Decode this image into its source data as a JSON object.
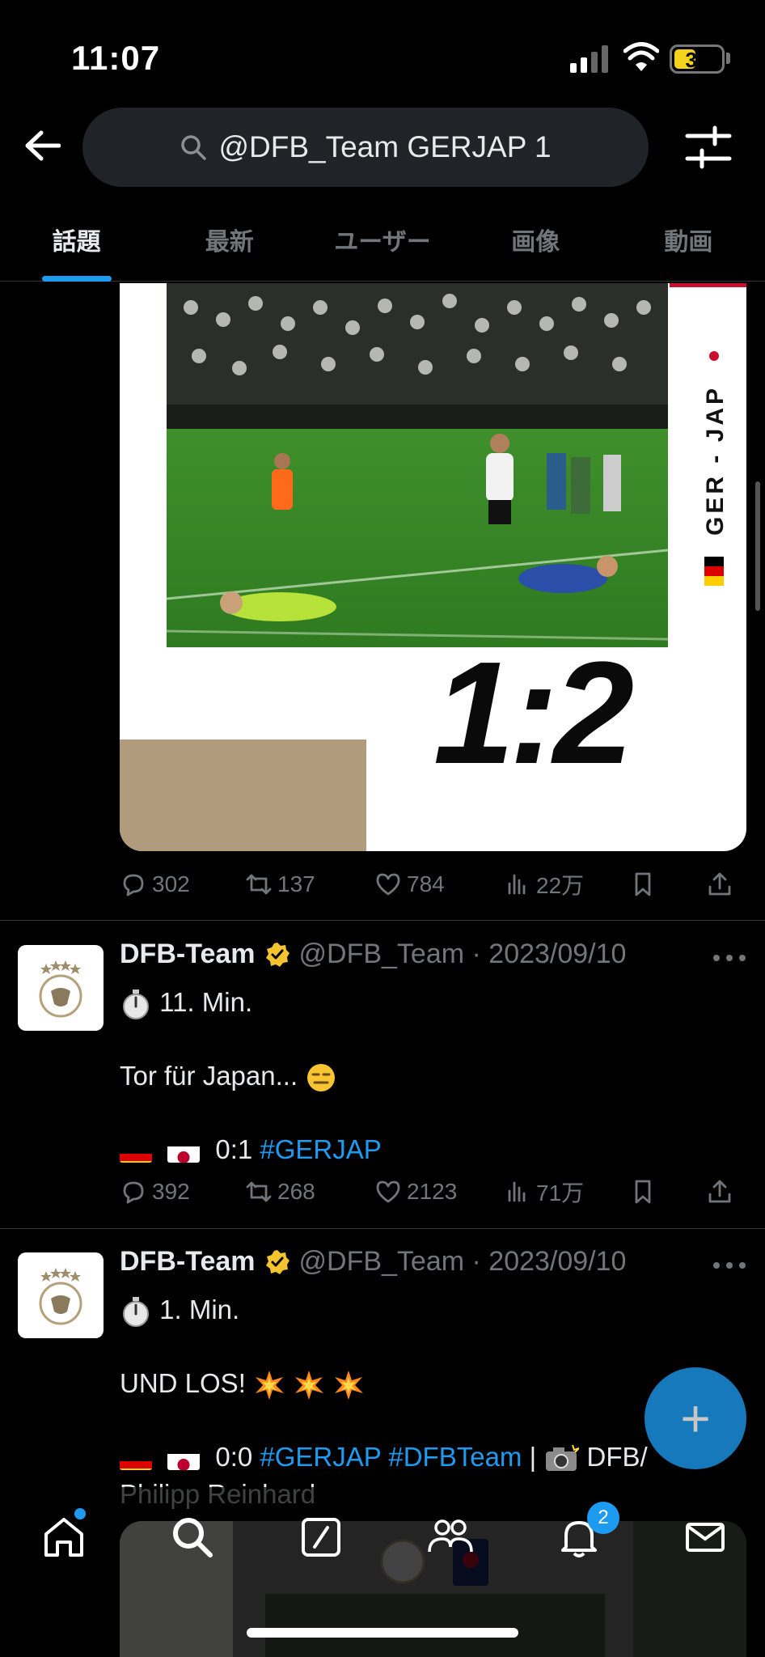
{
  "status": {
    "time": "11:07",
    "battery": "31"
  },
  "search": {
    "query": "@DFB_Team GERJAP 1"
  },
  "tabs": [
    {
      "label": "話題"
    },
    {
      "label": "最新"
    },
    {
      "label": "ユーザー"
    },
    {
      "label": "画像"
    },
    {
      "label": "動画"
    }
  ],
  "media": {
    "score": "1:2",
    "side_label": "GER - JAP"
  },
  "tweet0_stats": {
    "replies": "302",
    "retweets": "137",
    "likes": "784",
    "views": "22万"
  },
  "tweets": [
    {
      "name": "DFB-Team",
      "handle_date": "@DFB_Team · 2023/09/10",
      "line1": "11. Min.",
      "line2": "Tor für Japan...",
      "score": "0:1",
      "hashtag1": "#GERJAP",
      "stats": {
        "replies": "392",
        "retweets": "268",
        "likes": "2123",
        "views": "71万"
      }
    },
    {
      "name": "DFB-Team",
      "handle_date": "@DFB_Team · 2023/09/10",
      "line1": "1. Min.",
      "line2": "UND LOS!",
      "score": "0:0",
      "hashtag1": "#GERJAP",
      "hashtag2": "#DFBTeam",
      "credit_sep": "|",
      "credit": "DFB/",
      "credit2": "Philipp Reinhard"
    }
  ],
  "nav": {
    "notification_count": "2"
  },
  "colors": {
    "accent": "#1d9bf0",
    "background": "#000000",
    "muted": "#71767b",
    "verified": "#f4c430"
  }
}
